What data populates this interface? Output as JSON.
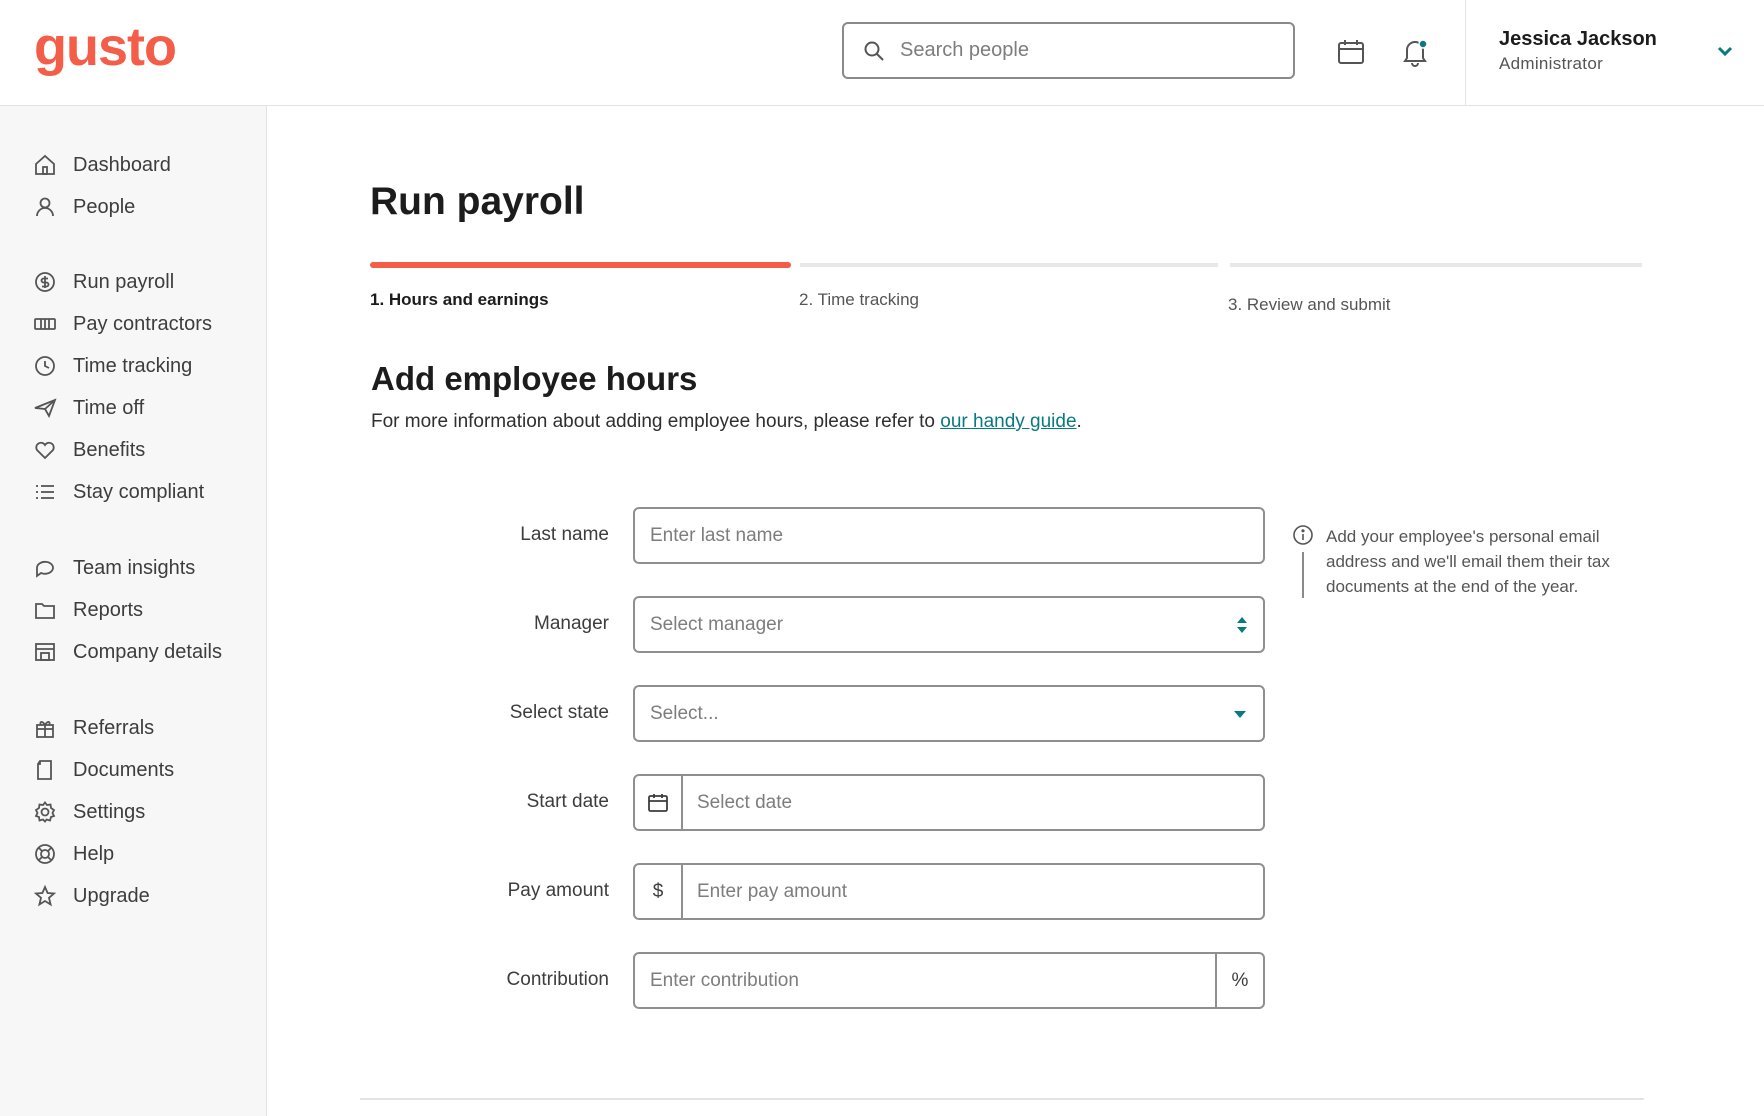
{
  "header": {
    "logo": "gusto",
    "search_placeholder": "Search people",
    "user_name": "Jessica Jackson",
    "user_role": "Administrator"
  },
  "sidebar": {
    "items": [
      {
        "label": "Dashboard",
        "icon": "home-icon"
      },
      {
        "label": "People",
        "icon": "person-icon"
      },
      {
        "label": "Run payroll",
        "icon": "dollar-circle-icon"
      },
      {
        "label": "Pay contractors",
        "icon": "money-bill-icon"
      },
      {
        "label": "Time tracking",
        "icon": "clock-icon"
      },
      {
        "label": "Time off",
        "icon": "plane-icon"
      },
      {
        "label": "Benefits",
        "icon": "heart-icon"
      },
      {
        "label": "Stay compliant",
        "icon": "list-icon"
      },
      {
        "label": "Team insights",
        "icon": "chat-bubble-icon"
      },
      {
        "label": "Reports",
        "icon": "folder-icon"
      },
      {
        "label": "Company details",
        "icon": "store-icon"
      },
      {
        "label": "Referrals",
        "icon": "gift-icon"
      },
      {
        "label": "Documents",
        "icon": "document-icon"
      },
      {
        "label": "Settings",
        "icon": "gear-icon"
      },
      {
        "label": "Help",
        "icon": "lifebuoy-icon"
      },
      {
        "label": "Upgrade",
        "icon": "star-icon"
      }
    ]
  },
  "main": {
    "title": "Run payroll",
    "steps": [
      {
        "label": "1. Hours and earnings",
        "active": true
      },
      {
        "label": "2. Time tracking",
        "active": false
      },
      {
        "label": "3. Review and submit",
        "active": false
      }
    ],
    "section_title": "Add employee hours",
    "section_desc_prefix": "For more information about adding employee hours, please refer to ",
    "section_desc_link": "our handy guide",
    "section_desc_suffix": ".",
    "form": {
      "last_name": {
        "label": "Last name",
        "placeholder": "Enter last name"
      },
      "manager": {
        "label": "Manager",
        "placeholder": "Select manager"
      },
      "state": {
        "label": "Select state",
        "placeholder": "Select..."
      },
      "start_date": {
        "label": "Start date",
        "placeholder": "Select date"
      },
      "pay_amount": {
        "label": "Pay amount",
        "prefix": "$",
        "placeholder": "Enter pay amount"
      },
      "contribution": {
        "label": "Contribution",
        "suffix": "%",
        "placeholder": "Enter contribution"
      }
    },
    "hint": "Add your employee's personal email address and we'll email them their tax documents at the end of the year."
  },
  "colors": {
    "brand": "#f45d48",
    "link": "#0a7a81",
    "accent": "#0a7a81"
  }
}
